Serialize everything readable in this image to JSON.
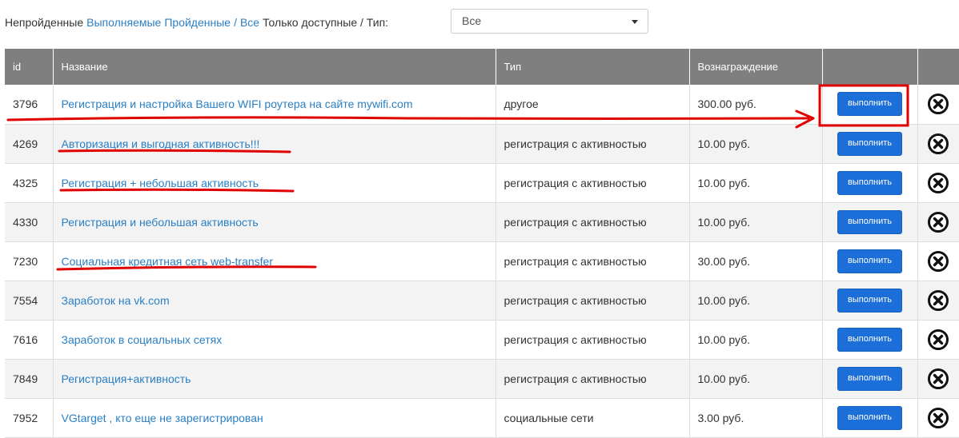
{
  "filter": {
    "not_passed": "Непройденные",
    "in_progress": "Выполняемые",
    "passed": "Пройденные",
    "separator": "/",
    "all": "Все",
    "only_available": "Только доступные / Тип:",
    "type_select": {
      "value": "Все"
    }
  },
  "table": {
    "headers": {
      "id": "id",
      "name": "Название",
      "type": "Тип",
      "reward": "Вознаграждение"
    },
    "action_label": "выполнить",
    "rows": [
      {
        "id": "3796",
        "name": "Регистрация и настройка Вашего WIFI роутера на сайте mywifi.com",
        "type": "другое",
        "reward": "300.00 руб."
      },
      {
        "id": "4269",
        "name": "Авторизация и выгодная активность!!!",
        "type": "регистрация с активностью",
        "reward": "10.00 руб."
      },
      {
        "id": "4325",
        "name": "Регистрация + небольшая активность",
        "type": "регистрация с активностью",
        "reward": "10.00 руб."
      },
      {
        "id": "4330",
        "name": "Регистрация и небольшая активность",
        "type": "регистрация с активностью",
        "reward": "10.00 руб."
      },
      {
        "id": "7230",
        "name": "Социальная кредитная сеть web-transfer",
        "type": "регистрация с активностью",
        "reward": "30.00 руб."
      },
      {
        "id": "7554",
        "name": "Заработок на vk.com",
        "type": "регистрация с активностью",
        "reward": "10.00 руб."
      },
      {
        "id": "7616",
        "name": "Заработок в социальных сетях",
        "type": "регистрация с активностью",
        "reward": "10.00 руб."
      },
      {
        "id": "7849",
        "name": "Регистрация+активность",
        "type": "регистрация с активностью",
        "reward": "10.00 руб."
      },
      {
        "id": "7952",
        "name": "VGtarget , кто еще не зарегистрирован",
        "type": "социальные сети",
        "reward": "3.00 руб."
      }
    ]
  },
  "icons": {
    "action": "button",
    "remove": "close-circle-icon"
  },
  "colors": {
    "link": "#2a7fc3",
    "header_bg": "#7f7f7f",
    "button": "#1c6fd8",
    "annotation": "#e00000"
  }
}
